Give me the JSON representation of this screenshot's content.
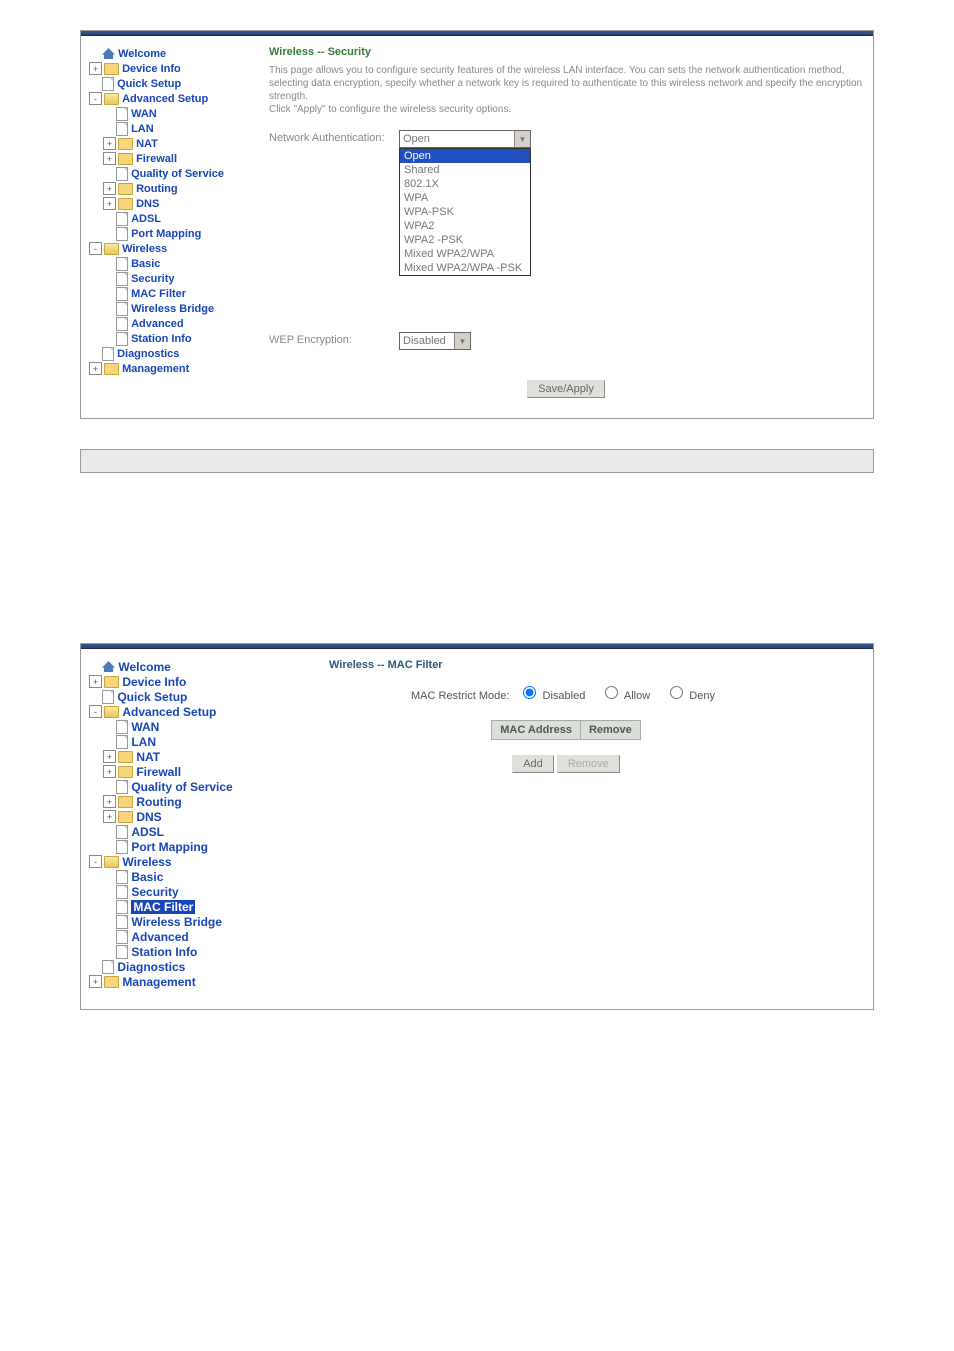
{
  "block1": {
    "title": "Wireless -- Security",
    "desc": "This page allows you to configure security features of the wireless LAN interface. You can sets the network authentication method, selecting data encryption, specify whether a network key is required to authenticate to this wireless network and specify the encryption strength.\nClick \"Apply\" to configure the wireless security options.",
    "auth_label": "Network Authentication:",
    "auth_value": "Open",
    "auth_options": [
      "Open",
      "Shared",
      "802.1X",
      "WPA",
      "WPA-PSK",
      "WPA2",
      "WPA2 -PSK",
      "Mixed WPA2/WPA",
      "Mixed WPA2/WPA -PSK"
    ],
    "wep_label": "WEP Encryption:",
    "wep_value": "Disabled",
    "save_btn": "Save/Apply"
  },
  "block2": {
    "title": "Wireless -- MAC Filter",
    "restrict_label": "MAC Restrict Mode:",
    "radio_disabled": "Disabled",
    "radio_allow": "Allow",
    "radio_deny": "Deny",
    "col_mac": "MAC Address",
    "col_remove": "Remove",
    "btn_add": "Add",
    "btn_remove": "Remove"
  },
  "nav": {
    "welcome": "Welcome",
    "device_info": "Device Info",
    "quick_setup": "Quick Setup",
    "advanced": "Advanced Setup",
    "wan": "WAN",
    "lan": "LAN",
    "nat": "NAT",
    "firewall": "Firewall",
    "qos": "Quality of Service",
    "routing": "Routing",
    "dns": "DNS",
    "adsl": "ADSL",
    "port_mapping": "Port Mapping",
    "wireless": "Wireless",
    "basic": "Basic",
    "security": "Security",
    "mac_filter": "MAC Filter",
    "wireless_bridge": "Wireless Bridge",
    "advanced_w": "Advanced",
    "station_info": "Station Info",
    "diagnostics": "Diagnostics",
    "management": "Management"
  }
}
